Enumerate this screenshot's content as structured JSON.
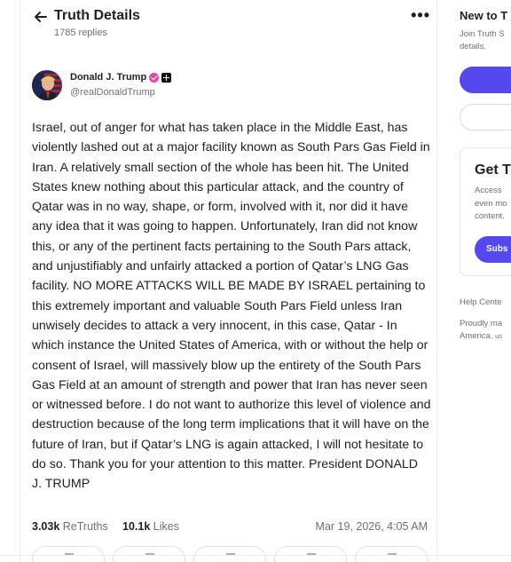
{
  "header": {
    "title": "Truth Details",
    "replies": "1785 replies"
  },
  "author": {
    "name": "Donald J. Trump",
    "handle": "@realDonaldTrump"
  },
  "post": {
    "text": "Israel, out of anger for what has taken place in the Middle East, has violently lashed out at a major facility known as South Pars Gas Field in Iran. A relatively small section of the whole has been hit. The United States knew nothing about this particular attack, and the country of Qatar was in no way, shape, or form, involved with it, nor did it have any idea that it was going to happen. Unfortunately, Iran did not know this, or any of the pertinent facts pertaining to the South Pars attack, and unjustifiably and unfairly attacked a portion of Qatar’s LNG Gas facility. NO MORE ATTACKS WILL BE MADE BY ISRAEL pertaining to this extremely important and valuable South Pars Field unless Iran unwisely decides to attack a very innocent, in this case, Qatar - In which instance the United States of America, with or without the help or consent of Israel, will massively blow up the entirety of the South Pars Gas Field at an amount of strength and power that Iran has never seen or witnessed before. I do not want to authorize this level of violence and destruction because of the long term implications that it will have on the future of Iran, but if Qatar’s LNG is again attacked, I will not hesitate to do so. Thank you for your attention to this matter. President DONALD J. TRUMP",
    "retruths_count": "3.03k",
    "retruths_label": "ReTruths",
    "likes_count": "10.1k",
    "likes_label": "Likes",
    "date": "Mar 19, 2026, 4:05 AM"
  },
  "sidebar": {
    "new_title": "New to T",
    "new_sub_line1": "Join Truth S",
    "new_sub_line2": "details.",
    "card_title": "Get T",
    "card_line1": "Access",
    "card_line2": "even mo",
    "card_line3": "content.",
    "card_button": "Subs",
    "help": "Help Cente",
    "proud_line1": "Proudly ma",
    "proud_line2": "America.",
    "proud_suffix": "us"
  },
  "colors": {
    "accent": "#5448ee",
    "verified_badge": "#e3499d",
    "muted_text": "#6b6f7b"
  }
}
